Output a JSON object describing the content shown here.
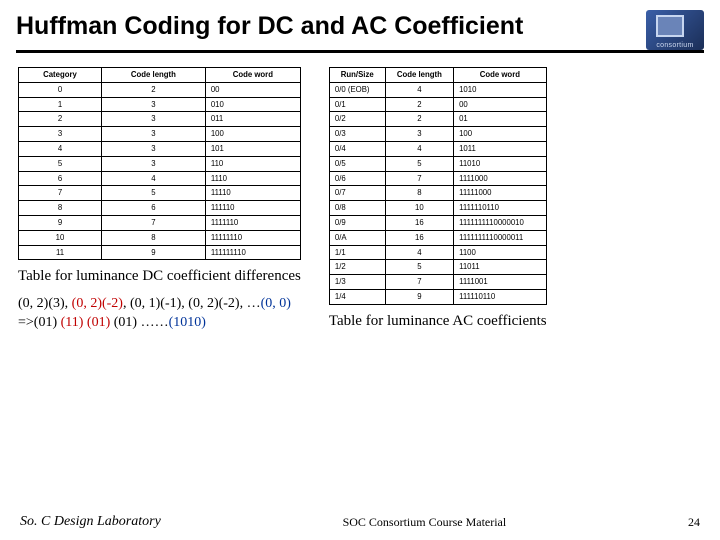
{
  "title": "Huffman Coding for DC and AC Coefficient",
  "logo_label": "consortium",
  "dc_table": {
    "headers": [
      "Category",
      "Code length",
      "Code word"
    ],
    "rows": [
      [
        "0",
        "2",
        "00"
      ],
      [
        "1",
        "3",
        "010"
      ],
      [
        "2",
        "3",
        "011"
      ],
      [
        "3",
        "3",
        "100"
      ],
      [
        "4",
        "3",
        "101"
      ],
      [
        "5",
        "3",
        "110"
      ],
      [
        "6",
        "4",
        "1110"
      ],
      [
        "7",
        "5",
        "11110"
      ],
      [
        "8",
        "6",
        "111110"
      ],
      [
        "9",
        "7",
        "1111110"
      ],
      [
        "10",
        "8",
        "11111110"
      ],
      [
        "11",
        "9",
        "111111110"
      ]
    ]
  },
  "ac_table": {
    "headers": [
      "Run/Size",
      "Code length",
      "Code word"
    ],
    "rows": [
      [
        "0/0  (EOB)",
        "4",
        "1010"
      ],
      [
        "0/1",
        "2",
        "00"
      ],
      [
        "0/2",
        "2",
        "01"
      ],
      [
        "0/3",
        "3",
        "100"
      ],
      [
        "0/4",
        "4",
        "1011"
      ],
      [
        "0/5",
        "5",
        "11010"
      ],
      [
        "0/6",
        "7",
        "1111000"
      ],
      [
        "0/7",
        "8",
        "11111000"
      ],
      [
        "0/8",
        "10",
        "1111110110"
      ],
      [
        "0/9",
        "16",
        "1111111110000010"
      ],
      [
        "0/A",
        "16",
        "1111111110000011"
      ],
      [
        "1/1",
        "4",
        "1100"
      ],
      [
        "1/2",
        "5",
        "11011"
      ],
      [
        "1/3",
        "7",
        "1111001"
      ],
      [
        "1/4",
        "9",
        "111110110"
      ]
    ]
  },
  "caption_dc": "Table for luminance DC coefficient differences",
  "caption_ac": "Table for luminance AC coefficients",
  "example": {
    "seq_pre": "(0, 2)(3), ",
    "seq_red": "(0, 2)(-2)",
    "seq_mid1": ", (0, 1)(-1), (0, 2)(-2), …",
    "seq_blue": "(0, 0)",
    "arrow": "=>",
    "code_pre": "(01) ",
    "code_red": "(11) (01)",
    "code_mid": " (01) ……",
    "code_blue": "(1010)"
  },
  "footer": {
    "left": "So. C Design Laboratory",
    "center": "SOC Consortium Course Material",
    "right": "24"
  }
}
